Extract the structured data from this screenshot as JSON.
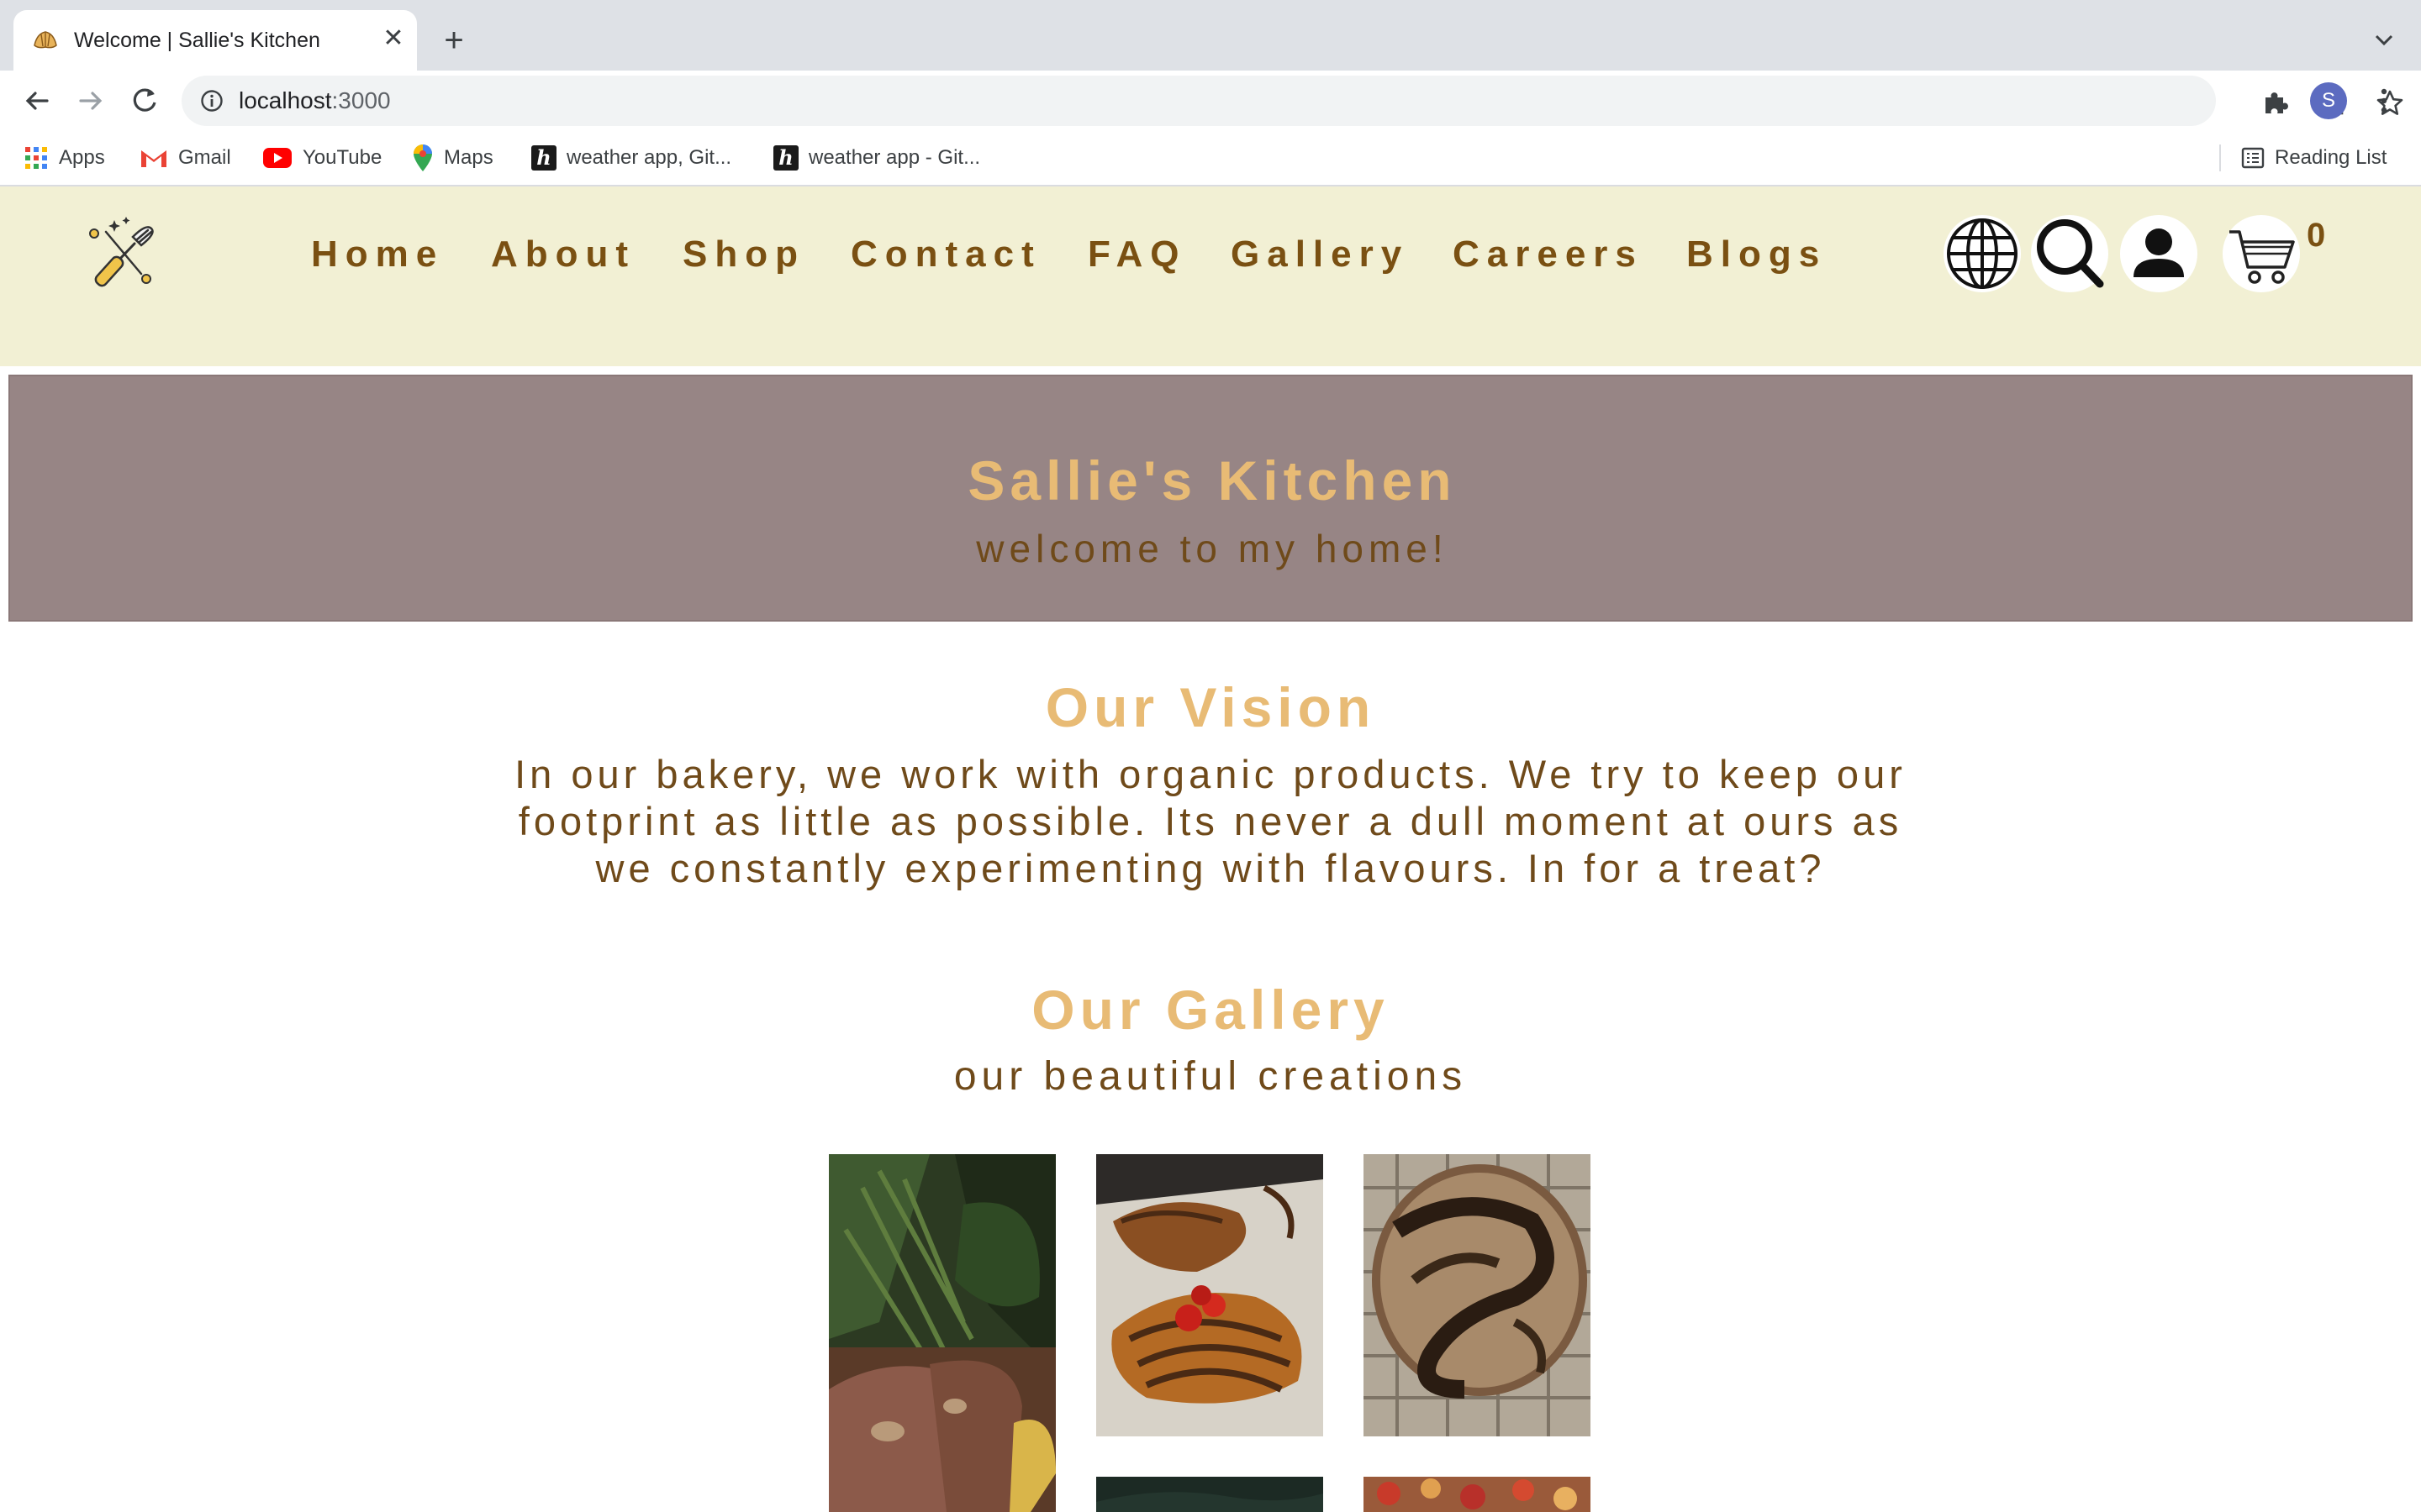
{
  "browser": {
    "tab_title": "Welcome | Sallie's Kitchen",
    "url_host": "localhost",
    "url_port": ":3000",
    "profile_initial": "S",
    "bookmarks": [
      {
        "label": "Apps",
        "icon": "apps-grid-icon"
      },
      {
        "label": "Gmail",
        "icon": "gmail-icon"
      },
      {
        "label": "YouTube",
        "icon": "youtube-icon"
      },
      {
        "label": "Maps",
        "icon": "maps-icon"
      },
      {
        "label": "weather app, Git...",
        "icon": "h-icon"
      },
      {
        "label": "weather app - Git...",
        "icon": "h-icon"
      }
    ],
    "reading_list": "Reading List"
  },
  "site": {
    "nav": [
      "Home",
      "About",
      "Shop",
      "Contact",
      "FAQ",
      "Gallery",
      "Careers",
      "Blogs"
    ],
    "cart_count": "0",
    "hero_title": "Sallie's Kitchen",
    "hero_subtitle": "welcome to my home!",
    "vision_title": "Our Vision",
    "vision_lines": [
      "In our bakery, we work with organic products. We try to keep our",
      "footprint as little as possible. Its never a dull moment at ours as",
      "we constantly experimenting with flavours. In for a treat?"
    ],
    "gallery_title": "Our Gallery",
    "gallery_subtitle": "our beautiful creations",
    "gallery_images": [
      "banana-bread-photo",
      "chocolate-croissant-photo",
      "sourdough-loaf-photo",
      "dark-pastry-photo",
      "berry-tart-photo"
    ]
  },
  "colors": {
    "header_bg": "#f2f0d4",
    "hero_bg": "#978585",
    "accent_gold": "#e8bb75",
    "text_brown": "#6f4a1a"
  }
}
